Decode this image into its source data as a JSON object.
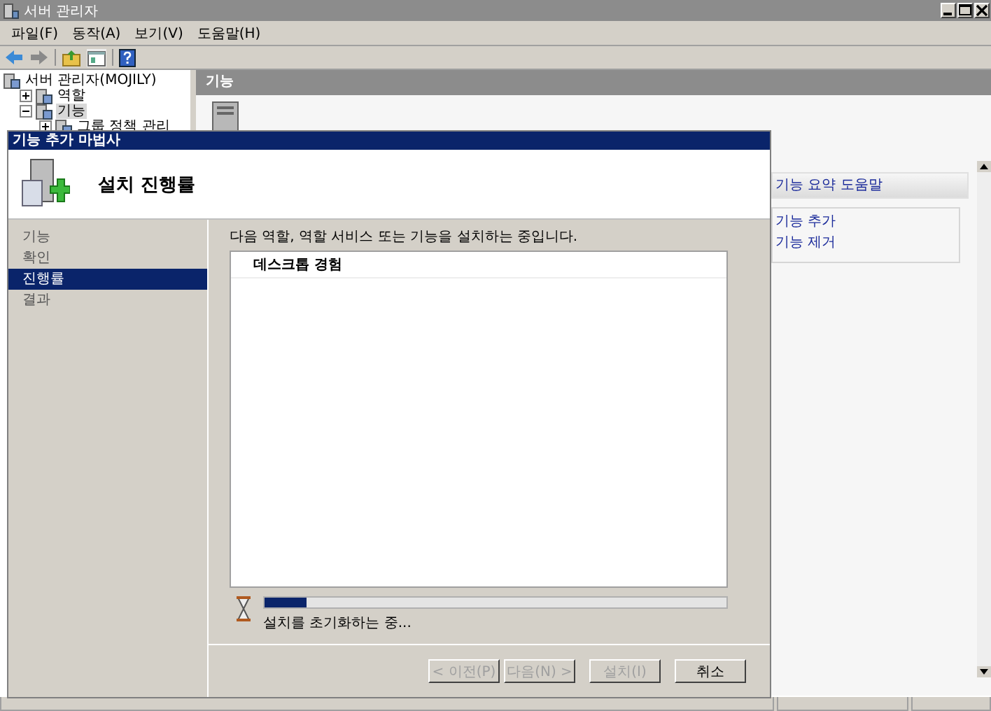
{
  "window": {
    "title": "서버 관리자"
  },
  "menu": [
    "파일(F)",
    "동작(A)",
    "보기(V)",
    "도움말(H)"
  ],
  "tree": [
    {
      "label": "서버 관리자(MOJILY)",
      "selected": false,
      "children": [
        {
          "label": "역할",
          "expanded": false,
          "selected": false
        },
        {
          "label": "기능",
          "expanded": true,
          "selected": true,
          "children": [
            {
              "label": "그룹 정책 관리",
              "expanded": false,
              "selected": false
            }
          ]
        }
      ]
    }
  ],
  "panel": {
    "title": "기능"
  },
  "actions": {
    "title": "기능 요약 도움말",
    "links": [
      "기능 추가",
      "기능 제거"
    ]
  },
  "dialog": {
    "title": "기능 추가 마법사",
    "heading": "설치 진행률",
    "steps": [
      {
        "label": "기능",
        "selected": false
      },
      {
        "label": "확인",
        "selected": false
      },
      {
        "label": "진행률",
        "selected": true
      },
      {
        "label": "결과",
        "selected": false
      }
    ],
    "intro": "다음 역할, 역할 서비스 또는 기능을 설치하는 중입니다.",
    "list_items": [
      "데스크톱 경험"
    ],
    "progress": {
      "level": 0.09,
      "status": "설치를 초기화하는 중..."
    },
    "buttons": [
      {
        "label": "< 이전(P)",
        "disabled": true
      },
      {
        "label": "다음(N) >",
        "disabled": true
      },
      {
        "label": "설치(I)",
        "disabled": true
      },
      {
        "label": "취소",
        "disabled": false
      }
    ]
  }
}
